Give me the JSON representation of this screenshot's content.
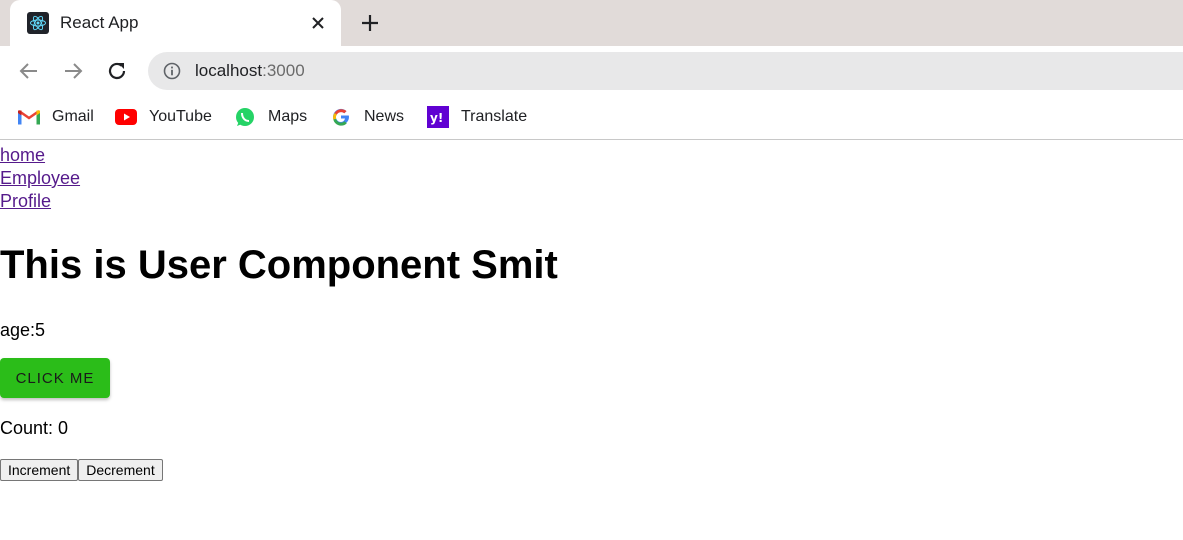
{
  "browser": {
    "tab_title": "React App",
    "url_host": "localhost",
    "url_port": ":3000"
  },
  "bookmarks": [
    {
      "label": "Gmail",
      "icon": "gmail-icon"
    },
    {
      "label": "YouTube",
      "icon": "youtube-icon"
    },
    {
      "label": "Maps",
      "icon": "maps-icon"
    },
    {
      "label": "News",
      "icon": "google-news-icon"
    },
    {
      "label": "Translate",
      "icon": "yahoo-icon"
    }
  ],
  "nav": {
    "home": "home",
    "employee": "Employee",
    "profile": "Profile"
  },
  "main": {
    "heading": "This is User Component Smit",
    "age_text": "age:5",
    "click_button": "CLICK ME",
    "count_text": "Count: 0",
    "increment_label": "Increment",
    "decrement_label": "Decrement"
  },
  "colors": {
    "click_button": "#2bbd19",
    "link_visited": "#551a8b",
    "tabstrip": "#e1dbd9"
  }
}
